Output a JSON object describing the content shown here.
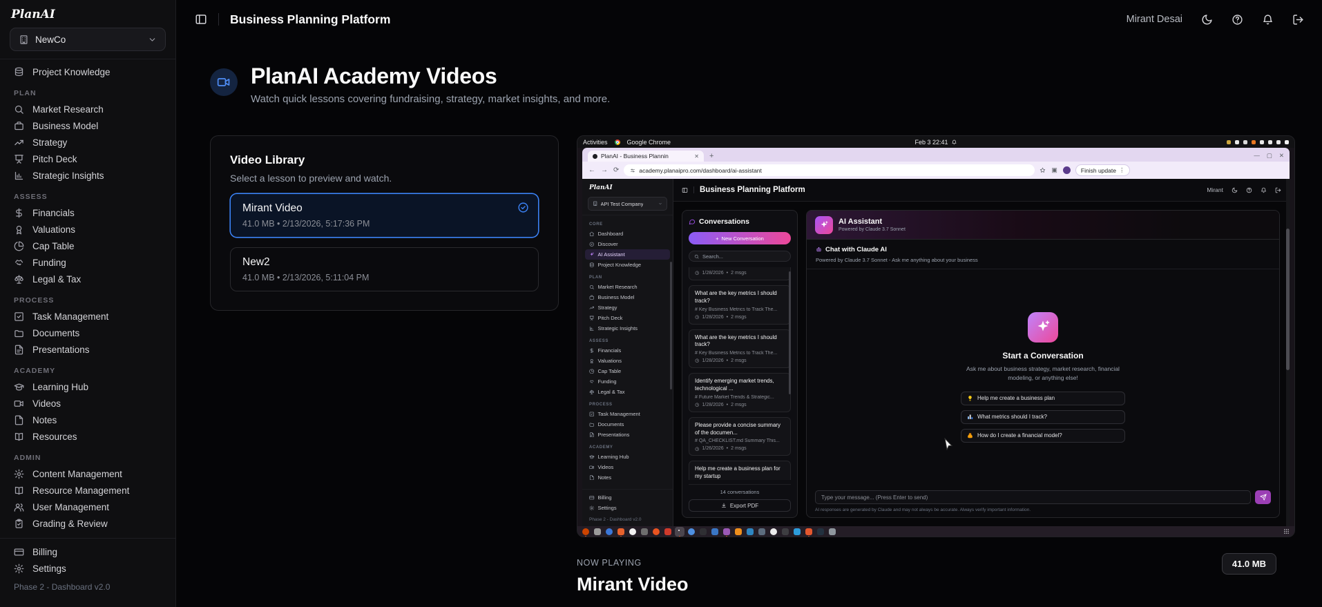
{
  "brand": {
    "logo": "PlanAI"
  },
  "colors": {
    "accent_blue": "#3b82f6",
    "accent_purple": "#a855f7",
    "accent_pink": "#ec4899"
  },
  "sidebar": {
    "company": {
      "name": "NewCo",
      "icon": "building",
      "chevron": "chevron-down"
    },
    "top_item": {
      "label": "Project Knowledge",
      "icon": "database"
    },
    "sections": [
      {
        "label": "PLAN",
        "items": [
          {
            "label": "Market Research",
            "icon": "search"
          },
          {
            "label": "Business Model",
            "icon": "briefcase"
          },
          {
            "label": "Strategy",
            "icon": "trend"
          },
          {
            "label": "Pitch Deck",
            "icon": "pitch"
          },
          {
            "label": "Strategic Insights",
            "icon": "insights"
          }
        ]
      },
      {
        "label": "ASSESS",
        "items": [
          {
            "label": "Financials",
            "icon": "dollar"
          },
          {
            "label": "Valuations",
            "icon": "award"
          },
          {
            "label": "Cap Table",
            "icon": "pie"
          },
          {
            "label": "Funding",
            "icon": "handshake"
          },
          {
            "label": "Legal & Tax",
            "icon": "scales"
          }
        ]
      },
      {
        "label": "PROCESS",
        "items": [
          {
            "label": "Task Management",
            "icon": "task"
          },
          {
            "label": "Documents",
            "icon": "folder"
          },
          {
            "label": "Presentations",
            "icon": "doc"
          }
        ]
      },
      {
        "label": "ACADEMY",
        "items": [
          {
            "label": "Learning Hub",
            "icon": "gradcap"
          },
          {
            "label": "Videos",
            "icon": "video"
          },
          {
            "label": "Notes",
            "icon": "note"
          },
          {
            "label": "Resources",
            "icon": "book"
          }
        ]
      },
      {
        "label": "ADMIN",
        "items": [
          {
            "label": "Content Management",
            "icon": "gear"
          },
          {
            "label": "Resource Management",
            "icon": "book"
          },
          {
            "label": "User Management",
            "icon": "users"
          },
          {
            "label": "Grading & Review",
            "icon": "clipboard"
          }
        ]
      }
    ],
    "footer_items": [
      {
        "label": "Billing",
        "icon": "card"
      },
      {
        "label": "Settings",
        "icon": "gear"
      }
    ],
    "footer_note": "Phase 2 - Dashboard v2.0"
  },
  "header": {
    "title": "Business Planning Platform",
    "user": "Mirant Desai",
    "icons": [
      "panel",
      "moon",
      "help",
      "bell",
      "logout"
    ]
  },
  "page": {
    "title": "PlanAI Academy Videos",
    "subtitle": "Watch quick lessons covering fundraising, strategy, market insights, and more.",
    "badge_icon": "video"
  },
  "library": {
    "title": "Video Library",
    "subtitle": "Select a lesson to preview and watch.",
    "items": [
      {
        "name": "Mirant Video",
        "meta": "41.0 MB • 2/13/2026, 5:17:36 PM",
        "selected": true,
        "check_icon": "check-circle"
      },
      {
        "name": "New2",
        "meta": "41.0 MB • 2/13/2026, 5:11:04 PM",
        "selected": false
      }
    ]
  },
  "now_playing": {
    "label": "NOW PLAYING",
    "title": "Mirant Video",
    "badge": "41.0 MB"
  },
  "video_frame": {
    "desktop": {
      "activities": "Activities",
      "app_name": "Google Chrome",
      "clock": "Feb 3 22:41"
    },
    "tray_icons": [
      "#caa53d",
      "#e8e8e8",
      "#d8d8d8",
      "#e87722",
      "#e8e8e8",
      "#e8e8e8",
      "#e8e8e8",
      "#f0f0f0"
    ],
    "chrome": {
      "tab": "PlanAI - Business Plannin",
      "url": "academy.planaipro.com/dashboard/ai-assistant",
      "update_button": "Finish update"
    },
    "app": {
      "logo": "PlanAI",
      "company": "API Test Company",
      "title": "Business Planning Platform",
      "user": "Mirant",
      "header_icons": [
        "moon",
        "help",
        "bell",
        "logout"
      ],
      "nav": {
        "sections": [
          {
            "label": "CORE",
            "items": [
              {
                "label": "Dashboard",
                "icon": "home"
              },
              {
                "label": "Discover",
                "icon": "compass"
              },
              {
                "label": "AI Assistant",
                "icon": "sparkle",
                "active": true
              },
              {
                "label": "Project Knowledge",
                "icon": "database"
              }
            ]
          },
          {
            "label": "PLAN",
            "items": [
              {
                "label": "Market Research",
                "icon": "search"
              },
              {
                "label": "Business Model",
                "icon": "briefcase"
              },
              {
                "label": "Strategy",
                "icon": "trend"
              },
              {
                "label": "Pitch Deck",
                "icon": "pitch"
              },
              {
                "label": "Strategic Insights",
                "icon": "insights"
              }
            ]
          },
          {
            "label": "ASSESS",
            "items": [
              {
                "label": "Financials",
                "icon": "dollar"
              },
              {
                "label": "Valuations",
                "icon": "award"
              },
              {
                "label": "Cap Table",
                "icon": "pie"
              },
              {
                "label": "Funding",
                "icon": "handshake"
              },
              {
                "label": "Legal & Tax",
                "icon": "scales"
              }
            ]
          },
          {
            "label": "PROCESS",
            "items": [
              {
                "label": "Task Management",
                "icon": "task"
              },
              {
                "label": "Documents",
                "icon": "folder"
              },
              {
                "label": "Presentations",
                "icon": "doc"
              }
            ]
          },
          {
            "label": "ACADEMY",
            "items": [
              {
                "label": "Learning Hub",
                "icon": "gradcap"
              },
              {
                "label": "Videos",
                "icon": "video"
              },
              {
                "label": "Notes",
                "icon": "note"
              }
            ]
          }
        ],
        "footer_items": [
          {
            "label": "Billing",
            "icon": "card"
          },
          {
            "label": "Settings",
            "icon": "gear"
          }
        ],
        "footer_note": "Phase 2 - Dashboard v2.0"
      },
      "conversations": {
        "title": "Conversations",
        "icon": "chat",
        "new_button": "New Conversation",
        "search_placeholder": "Search...",
        "items": [
          {
            "date": "1/28/2026",
            "msgs": "2 msgs",
            "clipped_top": true
          },
          {
            "title": "What are the key metrics I should track?",
            "subtitle": "# Key Business Metrics to Track The...",
            "date": "1/28/2026",
            "msgs": "2 msgs"
          },
          {
            "title": "What are the key metrics I should track?",
            "subtitle": "# Key Business Metrics to Track The...",
            "date": "1/28/2026",
            "msgs": "2 msgs"
          },
          {
            "title": "Identify emerging market trends, technological ...",
            "subtitle": "# Future Market Trends & Strategic...",
            "date": "1/28/2026",
            "msgs": "2 msgs"
          },
          {
            "title": "Please provide a concise summary of the documen...",
            "subtitle": "# QA_CHECKLIST.md Summary This...",
            "date": "1/26/2026",
            "msgs": "2 msgs"
          },
          {
            "title": "Help me create a business plan for my startup",
            "clipped_bottom": true
          }
        ],
        "count": "14 conversations",
        "export_label": "Export PDF",
        "export_icon": "download"
      },
      "assistant": {
        "title": "AI Assistant",
        "powered_by": "Powered by Claude 3.7 Sonnet",
        "band_icon": "sparkle",
        "chat_title": "Chat with Claude AI",
        "chat_icon": "robot",
        "chat_subtitle": "Powered by Claude 3.7 Sonnet - Ask me anything about your business",
        "empty_title": "Start a Conversation",
        "empty_icon": "sparkle",
        "empty_desc": "Ask me about business strategy, market research, financial modeling, or anything else!",
        "suggestions": [
          {
            "icon": "lightbulb",
            "label": "Help me create a business plan"
          },
          {
            "icon": "chart-mini",
            "label": "What metrics should I track?"
          },
          {
            "icon": "moneybag",
            "label": "How do I create a financial model?"
          }
        ],
        "input_placeholder": "Type your message... (Press Enter to send)",
        "send_icon": "send",
        "disclaimer": "AI responses are generated by Claude and may not always be accurate. Always verify important information."
      }
    },
    "dock_icons": [
      {
        "c": "#cc4400",
        "shape": "circle",
        "running": true
      },
      {
        "c": "#9b9b9b",
        "shape": "square"
      },
      {
        "c": "#3b77d8",
        "shape": "circle"
      },
      {
        "c": "#e8622d",
        "shape": "square",
        "running": true
      },
      {
        "c": "#f2f2f2",
        "shape": "circle"
      },
      {
        "c": "#6e6e6e",
        "shape": "square"
      },
      {
        "c": "#e95420",
        "shape": "circle"
      },
      {
        "c": "#cf3a2b",
        "shape": "square"
      },
      {
        "c": "chrome",
        "shape": "chrome",
        "running": true,
        "focused": true
      },
      {
        "c": "#4e8fe0",
        "shape": "circle"
      },
      {
        "c": "#2f2f33",
        "shape": "square"
      },
      {
        "c": "#3a76c4",
        "shape": "square"
      },
      {
        "c": "#9b59b6",
        "shape": "square",
        "running": true
      },
      {
        "c": "#ef8f1c",
        "shape": "square"
      },
      {
        "c": "#2e86c1",
        "shape": "square"
      },
      {
        "c": "#5d6d7e",
        "shape": "square"
      },
      {
        "c": "#ececec",
        "shape": "circle"
      },
      {
        "c": "#3d3d41",
        "shape": "square"
      },
      {
        "c": "#2d9cdb",
        "shape": "square"
      },
      {
        "c": "#e4572e",
        "shape": "square",
        "running": true
      },
      {
        "c": "#23313f",
        "shape": "square"
      },
      {
        "c": "#8f979e",
        "shape": "square"
      }
    ]
  }
}
